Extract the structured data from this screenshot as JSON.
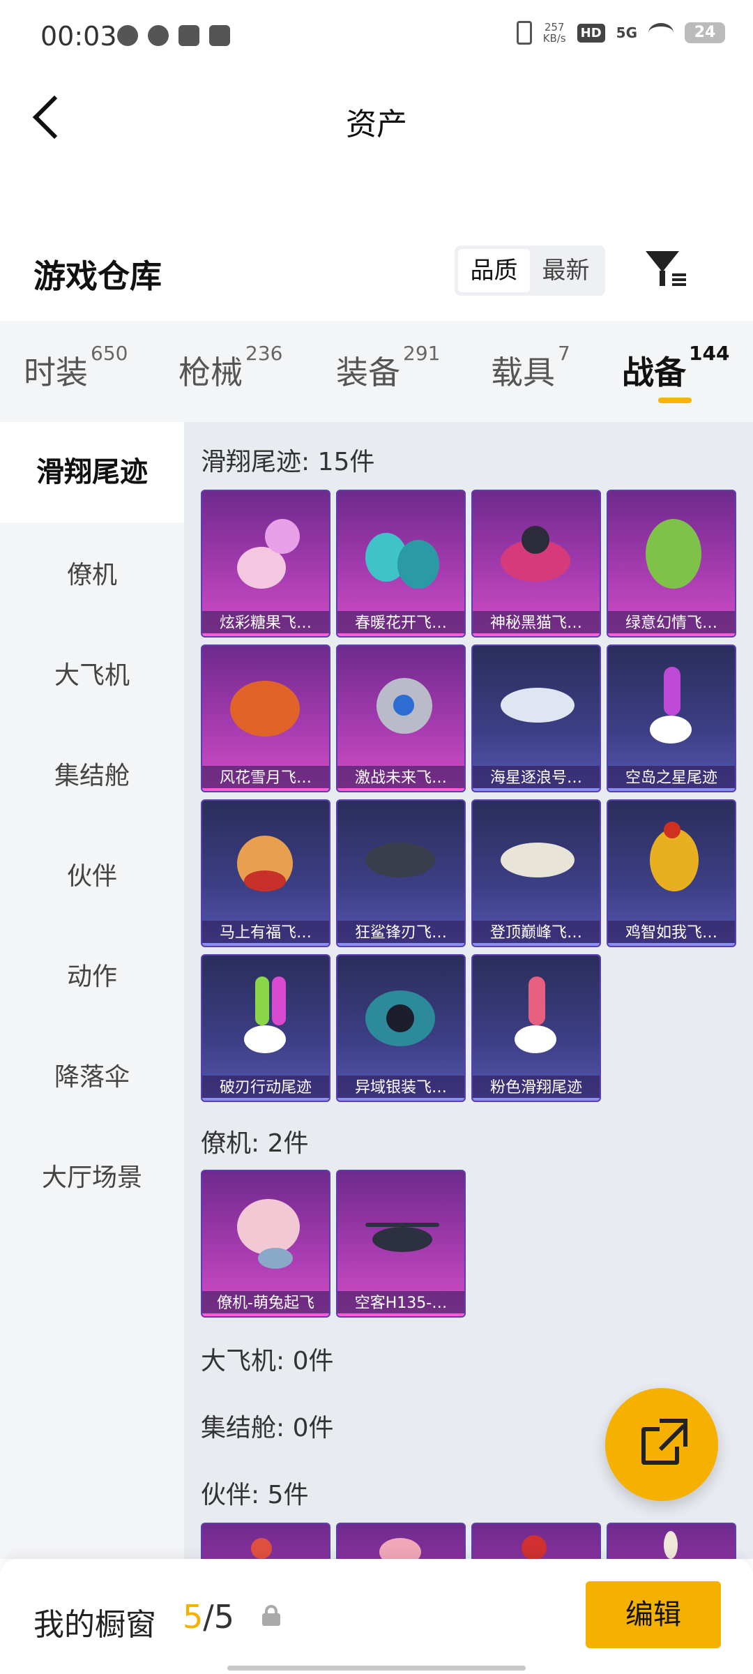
{
  "status_bar": {
    "time": "00:03",
    "speed_top": "257",
    "speed_unit": "KB/s",
    "hd": "HD",
    "network": "5G",
    "battery": "24"
  },
  "header": {
    "title": "资产"
  },
  "warehouse": {
    "title": "游戏仓库",
    "sort_options": [
      "品质",
      "最新"
    ],
    "active_sort": "品质"
  },
  "categories": [
    {
      "name": "时装",
      "count": "650"
    },
    {
      "name": "枪械",
      "count": "236"
    },
    {
      "name": "装备",
      "count": "291"
    },
    {
      "name": "载具",
      "count": "7"
    },
    {
      "name": "战备",
      "count": "144",
      "active": true
    }
  ],
  "side_nav": [
    "滑翔尾迹",
    "僚机",
    "大飞机",
    "集结舱",
    "伙伴",
    "动作",
    "降落伞",
    "大厅场景"
  ],
  "sections": {
    "glide": {
      "title": "滑翔尾迹: 15件"
    },
    "wingman": {
      "title": "僚机: 2件"
    },
    "bigplane": {
      "title": "大飞机: 0件"
    },
    "rally": {
      "title": "集结舱: 0件"
    },
    "partner": {
      "title": "伙伴: 5件"
    }
  },
  "glide_items": [
    {
      "label": "炫彩糖果飞…",
      "tier": "pink"
    },
    {
      "label": "春暖花开飞…",
      "tier": "pink"
    },
    {
      "label": "神秘黑猫飞…",
      "tier": "pink"
    },
    {
      "label": "绿意幻情飞…",
      "tier": "pink"
    },
    {
      "label": "风花雪月飞…",
      "tier": "pink"
    },
    {
      "label": "激战未来飞…",
      "tier": "pink"
    },
    {
      "label": "海星逐浪号…",
      "tier": "blue"
    },
    {
      "label": "空岛之星尾迹",
      "tier": "blue"
    },
    {
      "label": "马上有福飞…",
      "tier": "blue"
    },
    {
      "label": "狂鲨锋刃飞…",
      "tier": "blue"
    },
    {
      "label": "登顶巅峰飞…",
      "tier": "blue"
    },
    {
      "label": "鸡智如我飞…",
      "tier": "blue"
    },
    {
      "label": "破刃行动尾迹",
      "tier": "blue"
    },
    {
      "label": "异域银装飞…",
      "tier": "blue"
    },
    {
      "label": "粉色滑翔尾迹",
      "tier": "blue"
    }
  ],
  "wingman_items": [
    {
      "label": "僚机-萌兔起飞",
      "tier": "pink"
    },
    {
      "label": "空客H135-…",
      "tier": "pink"
    }
  ],
  "bottom_bar": {
    "title": "我的橱窗",
    "current": "5",
    "separator": "/",
    "total": "5",
    "edit_label": "编辑"
  },
  "colors": {
    "accent": "#f5b000",
    "pink_tier": "#a63bb0",
    "blue_tier": "#3d3f86"
  }
}
